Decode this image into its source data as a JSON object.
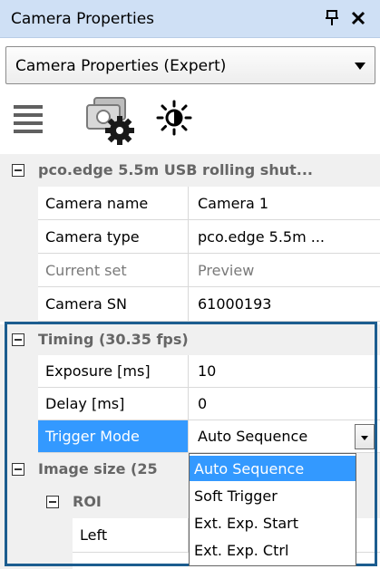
{
  "panel": {
    "title": "Camera Properties",
    "view_select": "Camera Properties (Expert)"
  },
  "toolbar": {
    "icons": [
      "list-icon",
      "camera-settings-icon",
      "brightness-icon"
    ]
  },
  "grid": {
    "camera_category": "pco.edge 5.5m USB rolling shut...",
    "camera_rows": [
      {
        "name": "Camera name",
        "value": "Camera 1"
      },
      {
        "name": "Camera type",
        "value": "pco.edge 5.5m ..."
      },
      {
        "name": "Current set",
        "value": "Preview"
      },
      {
        "name": "Camera SN",
        "value": "61000193"
      }
    ],
    "timing_category": "Timing (30.35 fps)",
    "timing_rows": [
      {
        "name": "Exposure [ms]",
        "value": "10"
      },
      {
        "name": "Delay [ms]",
        "value": "0"
      },
      {
        "name": "Trigger Mode",
        "value": "Auto Sequence"
      }
    ],
    "image_size_category": "Image size (25",
    "roi_category": "ROI",
    "roi_rows": [
      {
        "name": "Left"
      }
    ]
  },
  "trigger_dropdown": {
    "options": [
      "Auto Sequence",
      "Soft Trigger",
      "Ext. Exp. Start",
      "Ext. Exp. Ctrl"
    ],
    "selected": "Auto Sequence"
  },
  "colors": {
    "title_bar": "#cfe0f5",
    "selection": "#3399ff",
    "focus_border": "#1c5d8f"
  }
}
